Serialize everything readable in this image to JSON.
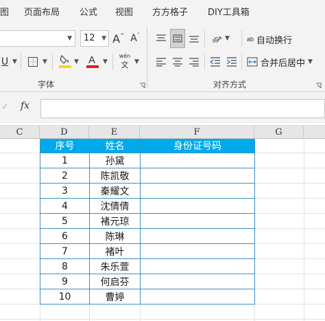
{
  "tabs": [
    {
      "label": "图"
    },
    {
      "label": "页面布局"
    },
    {
      "label": "公式"
    },
    {
      "label": "视图"
    },
    {
      "label": "方方格子"
    },
    {
      "label": "DIY工具箱"
    }
  ],
  "ribbon": {
    "font_size": "12",
    "grow_font_label": "A",
    "shrink_font_label": "A",
    "underline_label": "U",
    "font_color_label": "A",
    "phonetic_top": "wén",
    "phonetic_bottom": "文",
    "font_group_label": "字体",
    "align_group_label": "对齐方式",
    "wrap_text_label": "自动换行",
    "merge_center_label": "合并后居中",
    "wrap_icon_text": "ab",
    "colors": {
      "highlight": "#ffd700",
      "font_color": "#e0201b"
    }
  },
  "formula_bar": {
    "fx_label": "fx",
    "value": ""
  },
  "columns": [
    "C",
    "D",
    "E",
    "F",
    "G"
  ],
  "table": {
    "headers": [
      "序号",
      "姓名",
      "身份证号码"
    ],
    "rows": [
      [
        "1",
        "孙黛",
        ""
      ],
      [
        "2",
        "陈凯敬",
        ""
      ],
      [
        "3",
        "秦耀文",
        ""
      ],
      [
        "4",
        "沈倩倩",
        ""
      ],
      [
        "5",
        "褚元琼",
        ""
      ],
      [
        "6",
        "陈琳",
        ""
      ],
      [
        "7",
        "褚叶",
        ""
      ],
      [
        "8",
        "朱乐萱",
        ""
      ],
      [
        "9",
        "何启芬",
        ""
      ],
      [
        "10",
        "曹婷",
        ""
      ]
    ],
    "colors": {
      "header_bg": "#00aaec",
      "header_text": "#ffffff",
      "border": "#3d8ec9"
    }
  }
}
